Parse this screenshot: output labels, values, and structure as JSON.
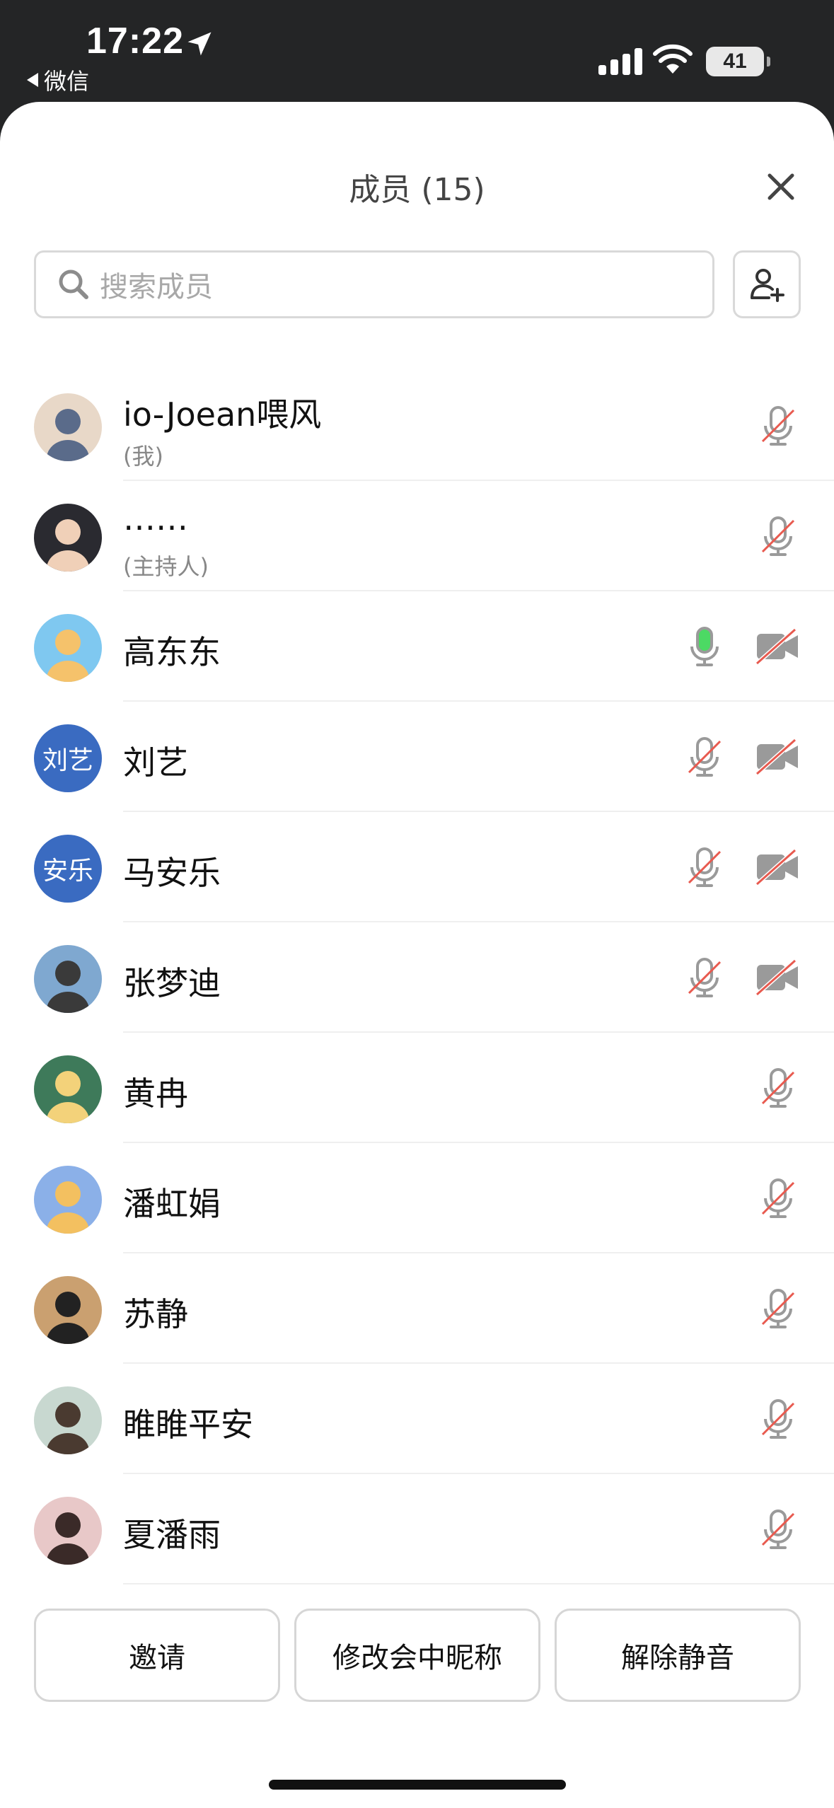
{
  "status_bar": {
    "time": "17:22",
    "back_app": "微信",
    "battery": "41"
  },
  "header": {
    "title": "成员 (15)"
  },
  "search": {
    "placeholder": "搜索成员"
  },
  "members": [
    {
      "name": "io-Joean喂风",
      "sub": "(我)",
      "avatar": "photo",
      "mic": "muted",
      "camera": null
    },
    {
      "name": "……",
      "sub": "(主持人)",
      "avatar": "photo",
      "mic": "muted",
      "camera": null
    },
    {
      "name": "高东东",
      "avatar": "photo",
      "mic": "active",
      "camera": "off"
    },
    {
      "name": "刘艺",
      "avatar": "initials",
      "avatar_text": "刘艺",
      "mic": "muted",
      "camera": "off"
    },
    {
      "name": "马安乐",
      "avatar": "initials",
      "avatar_text": "安乐",
      "mic": "muted",
      "camera": "off"
    },
    {
      "name": "张梦迪",
      "avatar": "photo",
      "mic": "muted",
      "camera": "off"
    },
    {
      "name": "黄冉",
      "avatar": "photo",
      "mic": "muted",
      "camera": null
    },
    {
      "name": "潘虹娟",
      "avatar": "photo",
      "mic": "muted",
      "camera": null
    },
    {
      "name": "苏静",
      "avatar": "photo",
      "mic": "muted",
      "camera": null
    },
    {
      "name": "睢睢平安",
      "avatar": "photo",
      "mic": "muted",
      "camera": null
    },
    {
      "name": "夏潘雨",
      "avatar": "photo",
      "mic": "muted",
      "camera": null
    }
  ],
  "actions": {
    "invite": "邀请",
    "rename": "修改会中昵称",
    "unmute": "解除静音"
  },
  "colors": {
    "accent_blue": "#3a6bc1",
    "mic_active": "#4cd964",
    "mute_slash": "#e85a4f",
    "icon_gray": "#9a9a9a"
  }
}
